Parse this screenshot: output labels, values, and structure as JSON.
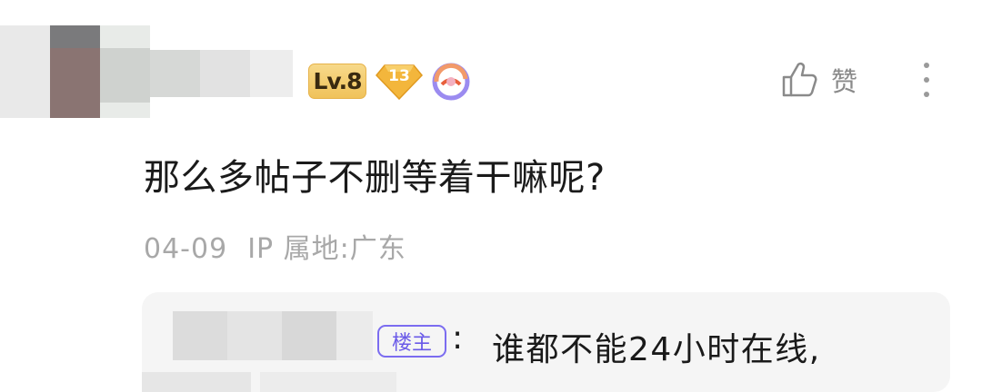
{
  "header": {
    "level_badge": "Lv.8",
    "gem_badge": "13",
    "like_label": "赞"
  },
  "post": {
    "content": "那么多帖子不删等着干嘛呢?",
    "date": "04-09",
    "ip_location": "IP 属地:广东"
  },
  "reply": {
    "owner_tag": "楼主",
    "colon": ":",
    "text": "谁都不能24小时在线,"
  },
  "icons": {
    "like": "thumbs-up-icon",
    "more": "more-vertical-icon",
    "gem": "gem-badge-icon",
    "ring": "ring-badge-icon"
  },
  "colors": {
    "level_badge_bg": "#f0c25a",
    "gem_badge": "#f3b63c",
    "owner_tag": "#7b6cf0",
    "meta_text": "#a8a8a8",
    "reply_bg": "#f5f5f5"
  }
}
